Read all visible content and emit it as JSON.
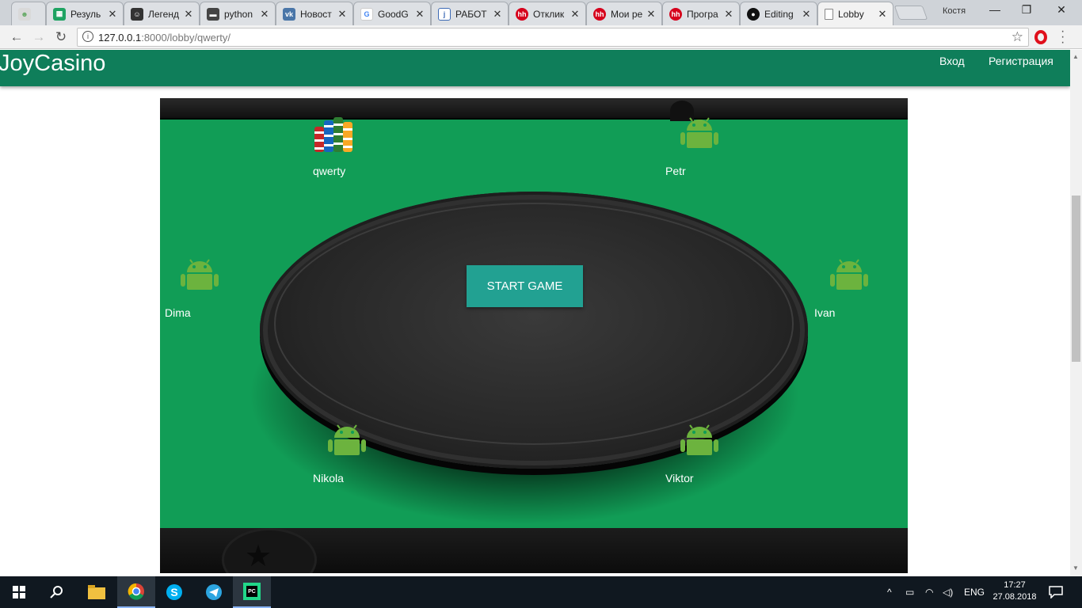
{
  "browser": {
    "tabs": [
      {
        "title": "",
        "icon": "pepe-icon",
        "color": "#d9d9d9"
      },
      {
        "title": "Резуль",
        "icon": "sheets-icon",
        "color": "#1ea362"
      },
      {
        "title": "Легенд",
        "icon": "face-icon",
        "color": "#333333"
      },
      {
        "title": "python",
        "icon": "glasses-icon",
        "color": "#444444"
      },
      {
        "title": "Новост",
        "icon": "vk-icon",
        "color": "#4a76a8"
      },
      {
        "title": "GoodG",
        "icon": "google-icon",
        "color": "#4285f4"
      },
      {
        "title": "РАБОТ",
        "icon": "j-icon",
        "color": "#3d6ab5"
      },
      {
        "title": "Отклик",
        "icon": "hh-icon",
        "color": "#d6001c"
      },
      {
        "title": "Мои ре",
        "icon": "hh-icon",
        "color": "#d6001c"
      },
      {
        "title": "Програ",
        "icon": "hh-icon",
        "color": "#d6001c"
      },
      {
        "title": "Editing",
        "icon": "github-icon",
        "color": "#111111"
      },
      {
        "title": "Lobby",
        "icon": "page-icon",
        "color": "#ffffff"
      }
    ],
    "profile": "Костя",
    "url_host": "127.0.0.1",
    "url_path": ":8000/lobby/qwerty/"
  },
  "site": {
    "brand": "JoyCasino",
    "login": "Вход",
    "register": "Регистрация"
  },
  "game": {
    "start_label": "START GAME",
    "players": {
      "p1": "qwerty",
      "p2": "Petr",
      "p3": "Dima",
      "p4": "Ivan",
      "p5": "Nikola",
      "p6": "Viktor"
    },
    "colors": {
      "felt": "#119d56",
      "button": "#22a192",
      "android": "#6cb33e"
    }
  },
  "taskbar": {
    "lang": "ENG",
    "time": "17:27",
    "date": "27.08.2018"
  }
}
